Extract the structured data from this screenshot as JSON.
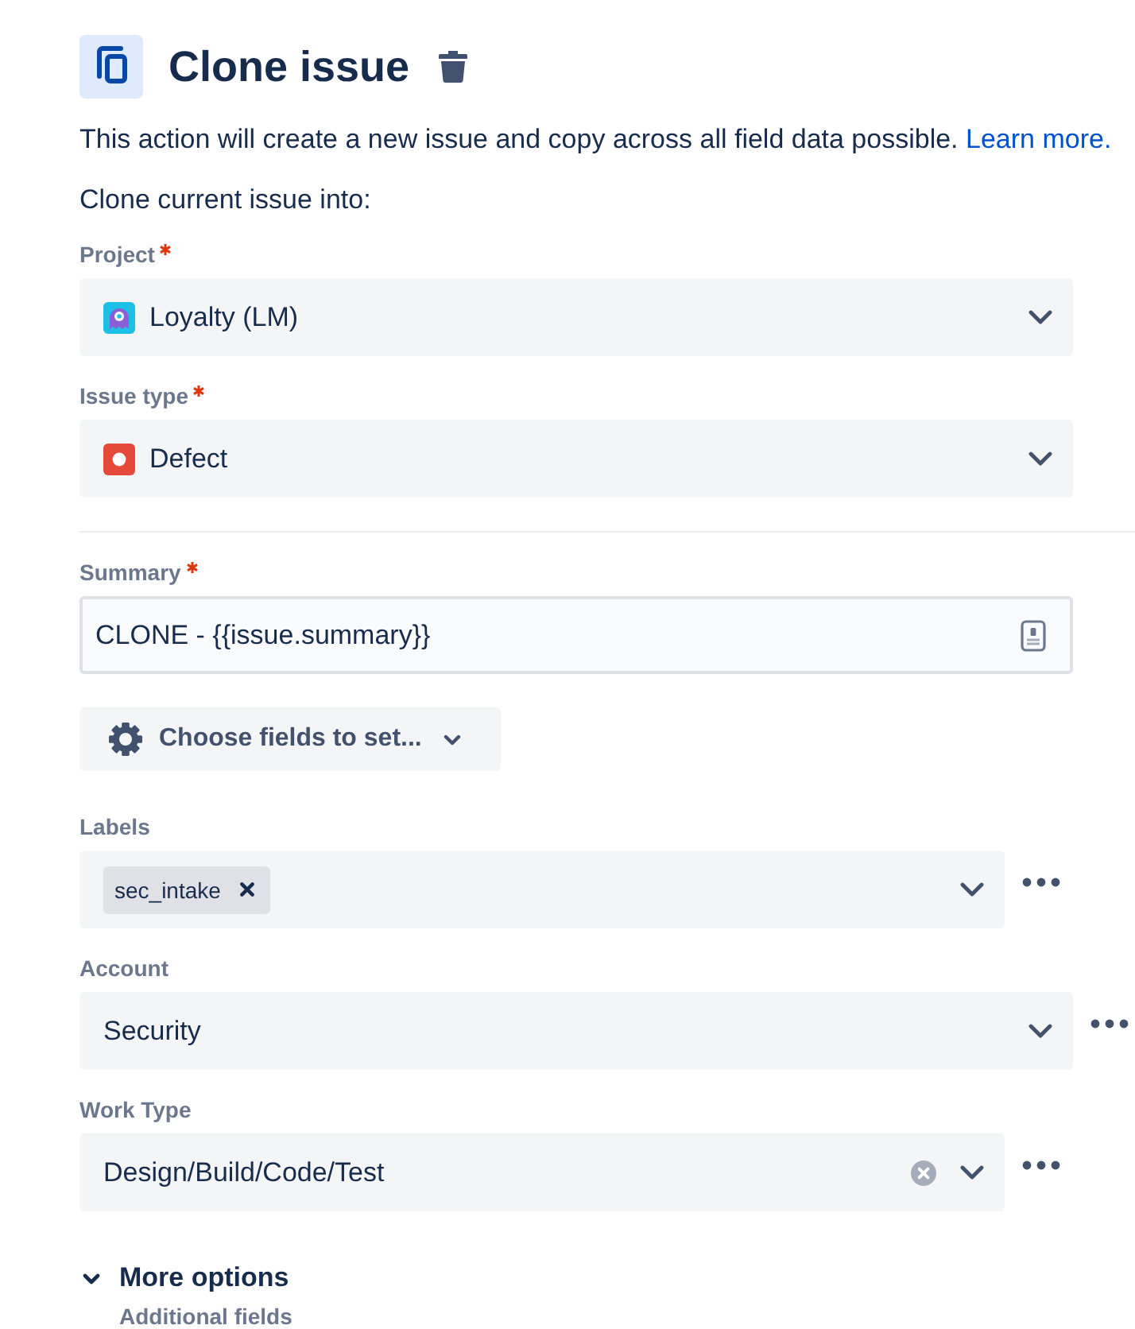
{
  "header": {
    "title": "Clone issue"
  },
  "description": {
    "text": "This action will create a new issue and copy across all field data possible.",
    "link": "Learn more."
  },
  "target": {
    "heading": "Clone current issue into:",
    "fields": [
      {
        "kind": "project_picker",
        "label": "Project",
        "required": true,
        "value": "Loyalty (LM)",
        "clearable": false,
        "actions_menu": false
      },
      {
        "kind": "issue_type_picker",
        "label": "Issue type",
        "required": true,
        "value": "Defect",
        "clearable": false,
        "actions_menu": false
      }
    ]
  },
  "summary": {
    "kind": "text",
    "label": "Summary",
    "required": true,
    "value": "CLONE - {{issue.summary}}",
    "clearable": false,
    "actions_menu": false
  },
  "choose_fields_button": {
    "label": "Choose fields to set..."
  },
  "fields": [
    {
      "kind": "label_picker",
      "label": "Labels",
      "required": false,
      "tags": [
        {
          "label": "sec_intake"
        }
      ],
      "clearable": false,
      "actions_menu": true
    },
    {
      "kind": "select",
      "label": "Account",
      "required": false,
      "value": "Security",
      "clearable": false,
      "actions_menu": true
    },
    {
      "kind": "select",
      "label": "Work Type",
      "required": false,
      "value": "Design/Build/Code/Test",
      "clearable": true,
      "actions_menu": true
    }
  ],
  "more_options": {
    "label": "More options",
    "expanded": true,
    "subtitle": "Additional fields"
  }
}
